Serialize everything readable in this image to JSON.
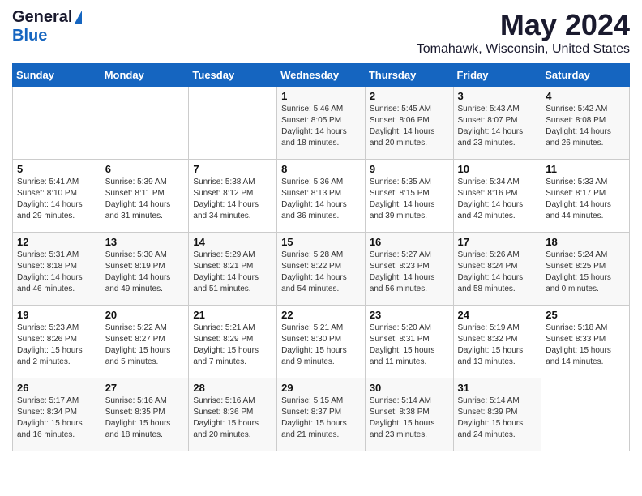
{
  "logo": {
    "general": "General",
    "blue": "Blue"
  },
  "title": {
    "month_year": "May 2024",
    "location": "Tomahawk, Wisconsin, United States"
  },
  "headers": [
    "Sunday",
    "Monday",
    "Tuesday",
    "Wednesday",
    "Thursday",
    "Friday",
    "Saturday"
  ],
  "weeks": [
    [
      {
        "day": "",
        "info": ""
      },
      {
        "day": "",
        "info": ""
      },
      {
        "day": "",
        "info": ""
      },
      {
        "day": "1",
        "info": "Sunrise: 5:46 AM\nSunset: 8:05 PM\nDaylight: 14 hours\nand 18 minutes."
      },
      {
        "day": "2",
        "info": "Sunrise: 5:45 AM\nSunset: 8:06 PM\nDaylight: 14 hours\nand 20 minutes."
      },
      {
        "day": "3",
        "info": "Sunrise: 5:43 AM\nSunset: 8:07 PM\nDaylight: 14 hours\nand 23 minutes."
      },
      {
        "day": "4",
        "info": "Sunrise: 5:42 AM\nSunset: 8:08 PM\nDaylight: 14 hours\nand 26 minutes."
      }
    ],
    [
      {
        "day": "5",
        "info": "Sunrise: 5:41 AM\nSunset: 8:10 PM\nDaylight: 14 hours\nand 29 minutes."
      },
      {
        "day": "6",
        "info": "Sunrise: 5:39 AM\nSunset: 8:11 PM\nDaylight: 14 hours\nand 31 minutes."
      },
      {
        "day": "7",
        "info": "Sunrise: 5:38 AM\nSunset: 8:12 PM\nDaylight: 14 hours\nand 34 minutes."
      },
      {
        "day": "8",
        "info": "Sunrise: 5:36 AM\nSunset: 8:13 PM\nDaylight: 14 hours\nand 36 minutes."
      },
      {
        "day": "9",
        "info": "Sunrise: 5:35 AM\nSunset: 8:15 PM\nDaylight: 14 hours\nand 39 minutes."
      },
      {
        "day": "10",
        "info": "Sunrise: 5:34 AM\nSunset: 8:16 PM\nDaylight: 14 hours\nand 42 minutes."
      },
      {
        "day": "11",
        "info": "Sunrise: 5:33 AM\nSunset: 8:17 PM\nDaylight: 14 hours\nand 44 minutes."
      }
    ],
    [
      {
        "day": "12",
        "info": "Sunrise: 5:31 AM\nSunset: 8:18 PM\nDaylight: 14 hours\nand 46 minutes."
      },
      {
        "day": "13",
        "info": "Sunrise: 5:30 AM\nSunset: 8:19 PM\nDaylight: 14 hours\nand 49 minutes."
      },
      {
        "day": "14",
        "info": "Sunrise: 5:29 AM\nSunset: 8:21 PM\nDaylight: 14 hours\nand 51 minutes."
      },
      {
        "day": "15",
        "info": "Sunrise: 5:28 AM\nSunset: 8:22 PM\nDaylight: 14 hours\nand 54 minutes."
      },
      {
        "day": "16",
        "info": "Sunrise: 5:27 AM\nSunset: 8:23 PM\nDaylight: 14 hours\nand 56 minutes."
      },
      {
        "day": "17",
        "info": "Sunrise: 5:26 AM\nSunset: 8:24 PM\nDaylight: 14 hours\nand 58 minutes."
      },
      {
        "day": "18",
        "info": "Sunrise: 5:24 AM\nSunset: 8:25 PM\nDaylight: 15 hours\nand 0 minutes."
      }
    ],
    [
      {
        "day": "19",
        "info": "Sunrise: 5:23 AM\nSunset: 8:26 PM\nDaylight: 15 hours\nand 2 minutes."
      },
      {
        "day": "20",
        "info": "Sunrise: 5:22 AM\nSunset: 8:27 PM\nDaylight: 15 hours\nand 5 minutes."
      },
      {
        "day": "21",
        "info": "Sunrise: 5:21 AM\nSunset: 8:29 PM\nDaylight: 15 hours\nand 7 minutes."
      },
      {
        "day": "22",
        "info": "Sunrise: 5:21 AM\nSunset: 8:30 PM\nDaylight: 15 hours\nand 9 minutes."
      },
      {
        "day": "23",
        "info": "Sunrise: 5:20 AM\nSunset: 8:31 PM\nDaylight: 15 hours\nand 11 minutes."
      },
      {
        "day": "24",
        "info": "Sunrise: 5:19 AM\nSunset: 8:32 PM\nDaylight: 15 hours\nand 13 minutes."
      },
      {
        "day": "25",
        "info": "Sunrise: 5:18 AM\nSunset: 8:33 PM\nDaylight: 15 hours\nand 14 minutes."
      }
    ],
    [
      {
        "day": "26",
        "info": "Sunrise: 5:17 AM\nSunset: 8:34 PM\nDaylight: 15 hours\nand 16 minutes."
      },
      {
        "day": "27",
        "info": "Sunrise: 5:16 AM\nSunset: 8:35 PM\nDaylight: 15 hours\nand 18 minutes."
      },
      {
        "day": "28",
        "info": "Sunrise: 5:16 AM\nSunset: 8:36 PM\nDaylight: 15 hours\nand 20 minutes."
      },
      {
        "day": "29",
        "info": "Sunrise: 5:15 AM\nSunset: 8:37 PM\nDaylight: 15 hours\nand 21 minutes."
      },
      {
        "day": "30",
        "info": "Sunrise: 5:14 AM\nSunset: 8:38 PM\nDaylight: 15 hours\nand 23 minutes."
      },
      {
        "day": "31",
        "info": "Sunrise: 5:14 AM\nSunset: 8:39 PM\nDaylight: 15 hours\nand 24 minutes."
      },
      {
        "day": "",
        "info": ""
      }
    ]
  ]
}
